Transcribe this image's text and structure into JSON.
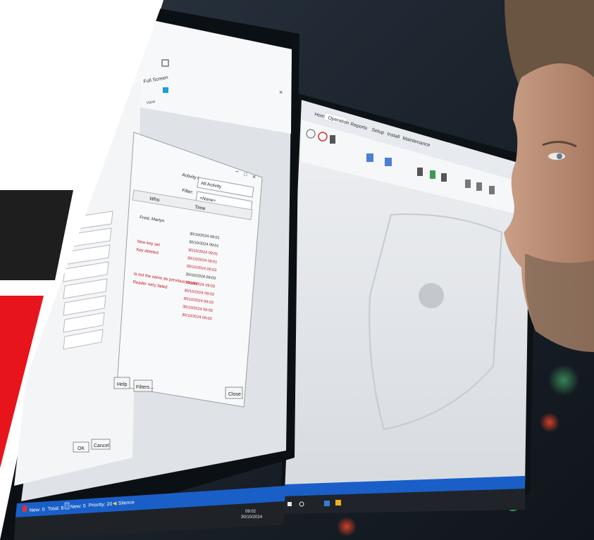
{
  "left_monitor": {
    "ribbon": {
      "full_screen_label": "Full Screen",
      "view_group_label": "View"
    },
    "activity_dialog": {
      "activity_type_label": "Activity type:",
      "activity_type_value": "All Activity",
      "filter_label": "Filter:",
      "filter_value": "<None>",
      "columns": [
        "Who",
        "Time"
      ],
      "rows": [
        {
          "who": "Frost, Martyn",
          "time": "",
          "color": "#222222"
        },
        {
          "who": "",
          "time": "30/10/2024 09:01",
          "color": "#222222"
        },
        {
          "who": "",
          "time": "30/10/2024 09:01",
          "color": "#222222"
        },
        {
          "who": "New key set",
          "time": "30/10/2024 09:01",
          "color": "#c0101a"
        },
        {
          "who": "Key deleted",
          "time": "30/10/2024 09:01",
          "color": "#c0101a"
        },
        {
          "who": "",
          "time": "30/10/2024 09:03",
          "color": "#c0101a"
        },
        {
          "who": "",
          "time": "30/10/2024 09:03",
          "color": "#222222"
        },
        {
          "who": "Is not the same as previous reader",
          "time": "30/10/2024 09:03",
          "color": "#c0101a"
        },
        {
          "who": "Reader retry failed",
          "time": "30/10/2024 09:03",
          "color": "#c0101a"
        },
        {
          "who": "",
          "time": "30/10/2024 09:03",
          "color": "#c0101a"
        },
        {
          "who": "",
          "time": "30/10/2024 09:03",
          "color": "#c0101a"
        },
        {
          "who": "",
          "time": "30/10/2024 09:03",
          "color": "#c0101a"
        }
      ],
      "help_button": "Help",
      "filters_button": "Filters...",
      "close_button": "Close"
    },
    "back_dialog": {
      "ok_button": "OK",
      "cancel_button": "Cancel"
    },
    "status_bar": {
      "new_label": "New: 0",
      "total_label": "Total: 8",
      "new2_label": "New: 0",
      "priority_label": "Priority: 20",
      "silence_label": "Silence"
    },
    "taskbar": {
      "time": "09:02",
      "date": "30/10/2024"
    }
  },
  "right_monitor": {
    "tabs": [
      "Home",
      "Operation",
      "Reports",
      "Setup",
      "Install",
      "Maintenance"
    ],
    "active_tab": "Operation"
  },
  "colors": {
    "brand_red": "#e8141c",
    "brand_dark": "#1e1e1e",
    "status_bar_blue": "#1a5fc8",
    "alarm_red": "#c0101a"
  }
}
